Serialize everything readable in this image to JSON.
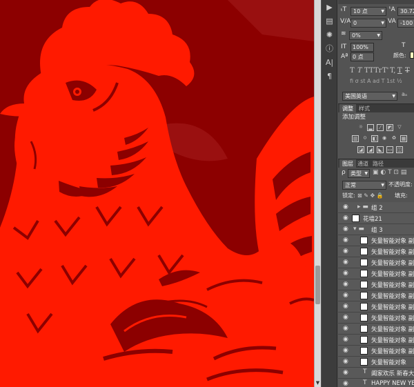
{
  "colors": {
    "canvas_bg": "#8c0000",
    "rooster_red": "#ff1a00",
    "dark_detail": "#8c0000",
    "panel_bg": "#535353",
    "scroll_bg": "#d9d9d9"
  },
  "character_panel": {
    "font_size": "10 点",
    "leading": "30.72",
    "kerning": "0",
    "tracking": "-100",
    "baseline_shift_pct": "0%",
    "vertical_scale": "100%",
    "baseline": "0 点",
    "color_label": "颜色:",
    "style_buttons": [
      "T",
      "T",
      "TT",
      "Tr",
      "T'",
      "T,",
      "T",
      "T"
    ],
    "language": "美国英语"
  },
  "adjustments_panel": {
    "tabs": [
      "调整",
      "样式"
    ],
    "add_label": "添加调整"
  },
  "layers_panel": {
    "tabs": [
      "图层",
      "通道",
      "路径"
    ],
    "filter": "类型",
    "blend_mode": "正常",
    "opacity_label": "不透明度:",
    "lock_label": "锁定:",
    "fill_label": "填充:",
    "layers": [
      {
        "name": "组 2",
        "kind": "group",
        "expanded": false
      },
      {
        "name": "花墙21",
        "kind": "pixel"
      },
      {
        "name": "组 3",
        "kind": "group",
        "expanded": true
      },
      {
        "name": "矢量智能对象 副",
        "kind": "smart"
      },
      {
        "name": "矢量智能对象 副",
        "kind": "smart"
      },
      {
        "name": "矢量智能对象 副",
        "kind": "smart"
      },
      {
        "name": "矢量智能对象 副",
        "kind": "smart"
      },
      {
        "name": "矢量智能对象 副",
        "kind": "smart"
      },
      {
        "name": "矢量智能对象 副",
        "kind": "smart"
      },
      {
        "name": "矢量智能对象 副",
        "kind": "smart"
      },
      {
        "name": "矢量智能对象 副",
        "kind": "smart"
      },
      {
        "name": "矢量智能对象 副",
        "kind": "smart"
      },
      {
        "name": "矢量智能对象 副",
        "kind": "smart"
      },
      {
        "name": "矢量智能对象 副",
        "kind": "smart"
      },
      {
        "name": "矢量智能对象",
        "kind": "smart"
      },
      {
        "name": "阖家欢乐 新春大",
        "kind": "text"
      },
      {
        "name": "HAPPY NEW YEAR",
        "kind": "text"
      }
    ]
  }
}
